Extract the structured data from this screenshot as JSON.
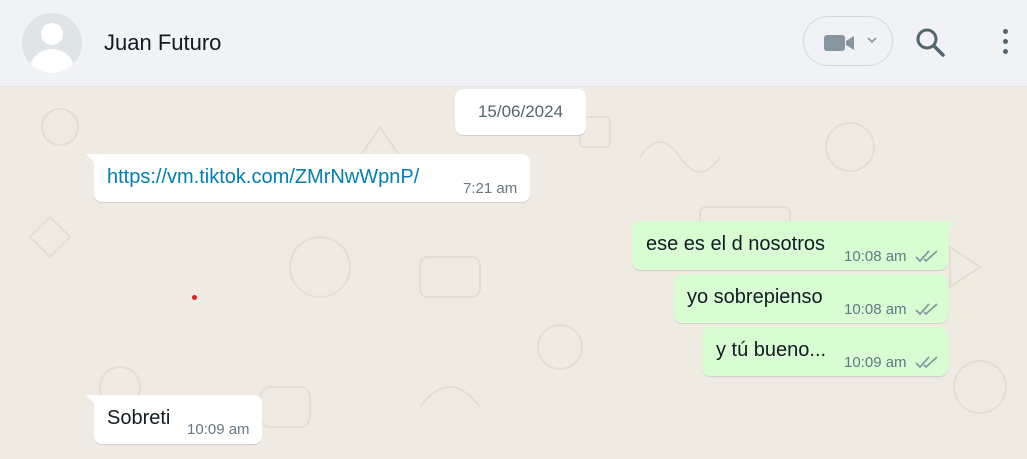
{
  "header": {
    "contact_name": "Juan Futuro",
    "icons": {
      "avatar": "default-avatar",
      "video": "video-camera-icon",
      "search": "search-icon",
      "menu": "more-vertical-icon"
    }
  },
  "chat": {
    "date_chip": "15/06/2024",
    "messages": [
      {
        "direction": "in",
        "text": "https://vm.tiktok.com/ZMrNwWpnP/",
        "time": "7:21 am",
        "is_link": true
      },
      {
        "direction": "out",
        "text": "ese es el d nosotros",
        "time": "10:08 am",
        "status": "read"
      },
      {
        "direction": "out",
        "text": "yo sobrepienso",
        "time": "10:08 am",
        "status": "read"
      },
      {
        "direction": "out",
        "text": "y tú bueno...",
        "time": "10:09 am",
        "status": "read"
      },
      {
        "direction": "in",
        "text": "Sobreti",
        "time": "10:09 am"
      }
    ]
  },
  "colors": {
    "incoming": "#ffffff",
    "outgoing": "#d9fdd3",
    "link": "#027eb5",
    "background": "#efeae2"
  }
}
